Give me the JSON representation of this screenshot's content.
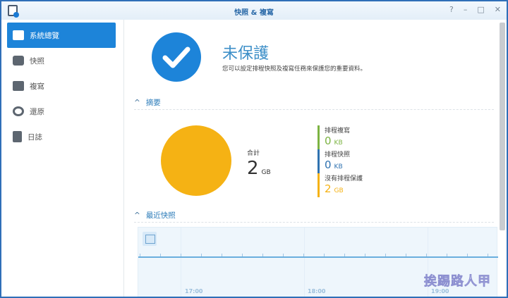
{
  "window": {
    "title": "快照 & 複寫",
    "controls": [
      "?",
      "–",
      "□",
      "✕"
    ]
  },
  "sidebar": {
    "items": [
      {
        "label": "系統總覽",
        "icon": "overview-icon",
        "active": true
      },
      {
        "label": "快照",
        "icon": "camera-icon"
      },
      {
        "label": "複寫",
        "icon": "replication-icon"
      },
      {
        "label": "還原",
        "icon": "restore-icon"
      },
      {
        "label": "日誌",
        "icon": "log-icon"
      }
    ]
  },
  "status": {
    "title": "未保護",
    "description": "您可以設定排程快照及複寫任務來保護您的重要資料。"
  },
  "summary": {
    "heading": "摘要",
    "total_label": "合計",
    "total_value": "2",
    "total_unit": "GB",
    "legend": [
      {
        "label": "排程複寫",
        "value": "0",
        "unit": "KB",
        "color": "#7cb342"
      },
      {
        "label": "排程快照",
        "value": "0",
        "unit": "KB",
        "color": "#2f72b0"
      },
      {
        "label": "沒有排程保護",
        "value": "2",
        "unit": "GB",
        "color": "#f5b214"
      }
    ]
  },
  "recent": {
    "heading": "最近快照",
    "times": [
      "17:00",
      "18:00",
      "19:00"
    ]
  },
  "watermark": "挨踢路人甲"
}
